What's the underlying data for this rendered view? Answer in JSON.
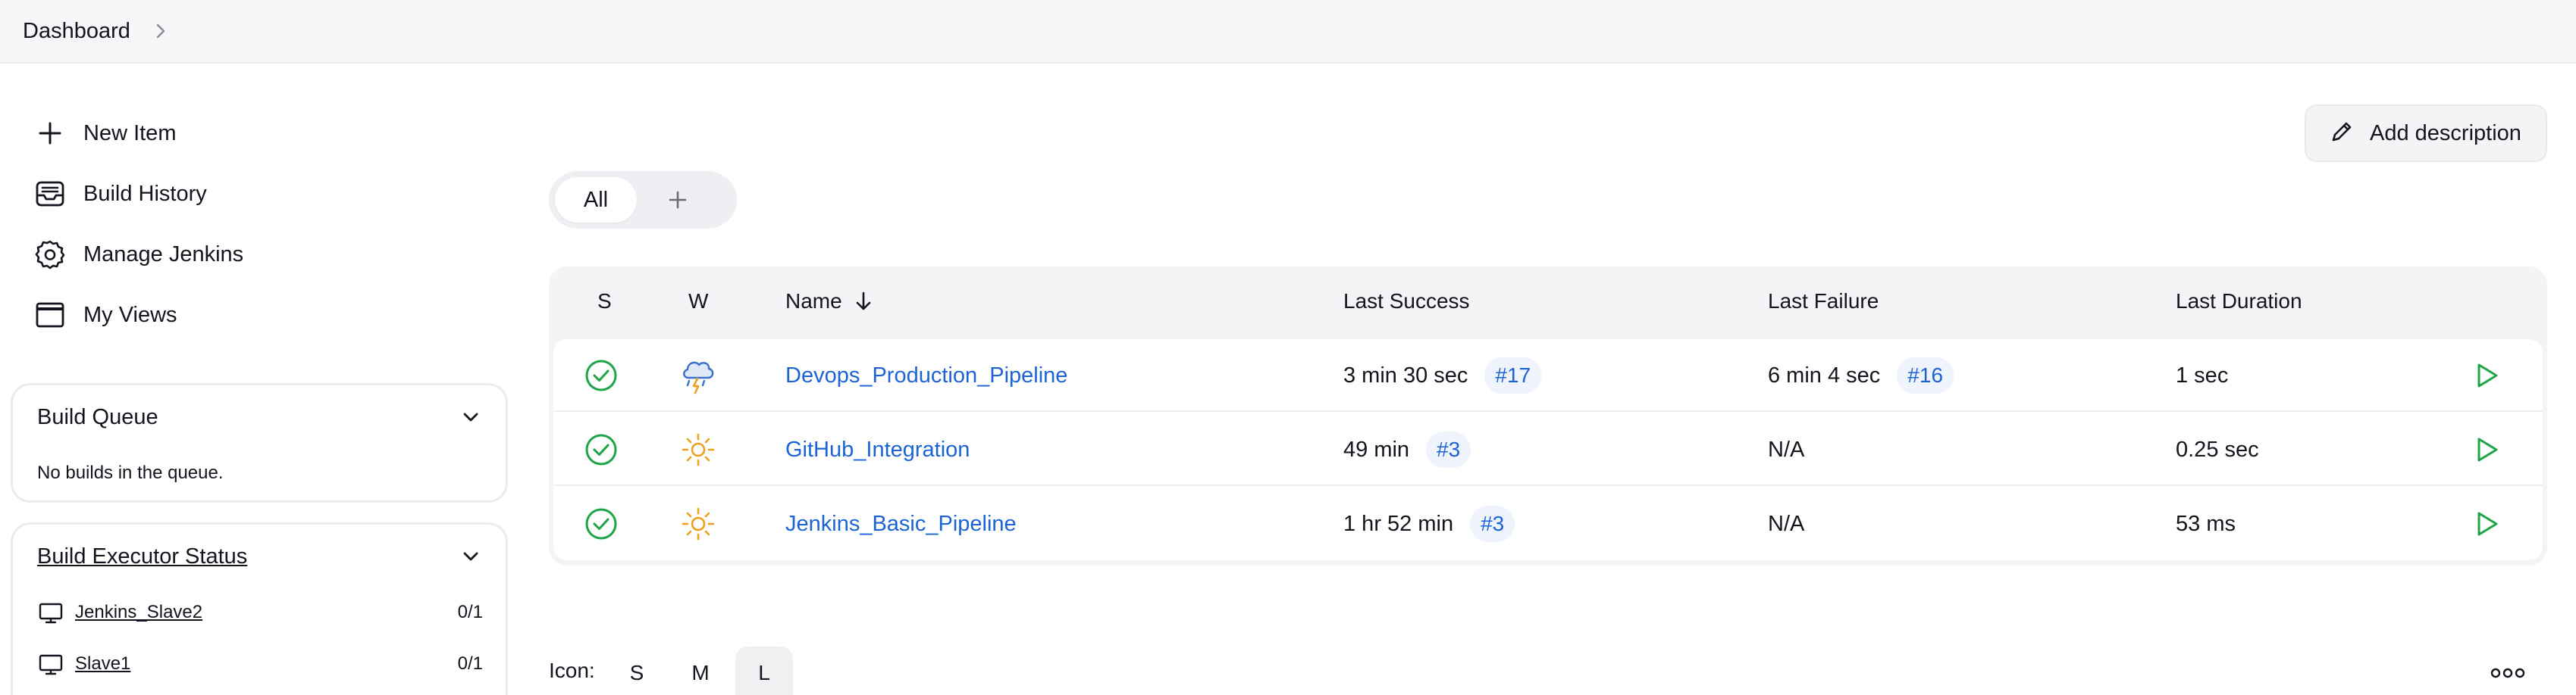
{
  "breadcrumb": {
    "root": "Dashboard"
  },
  "tasks": [
    {
      "label": "New Item",
      "icon": "plus-icon"
    },
    {
      "label": "Build History",
      "icon": "inbox-icon"
    },
    {
      "label": "Manage Jenkins",
      "icon": "gear-icon"
    },
    {
      "label": "My Views",
      "icon": "window-icon"
    }
  ],
  "build_queue": {
    "title": "Build Queue",
    "empty_text": "No builds in the queue."
  },
  "executors": {
    "title": "Build Executor Status",
    "nodes": [
      {
        "name": "Jenkins_Slave2",
        "count": "0/1"
      },
      {
        "name": "Slave1",
        "count": "0/1"
      }
    ]
  },
  "add_description": {
    "label": "Add description"
  },
  "view_tabs": {
    "all": "All"
  },
  "table": {
    "headers": {
      "s": "S",
      "w": "W",
      "name": "Name",
      "last_success": "Last Success",
      "last_failure": "Last Failure",
      "last_duration": "Last Duration"
    },
    "rows": [
      {
        "status": "success",
        "weather": "thunderstorm-icon",
        "name": "Devops_Production_Pipeline",
        "last_success": "3 min 30 sec",
        "success_build": "#17",
        "last_failure": "6 min 4 sec",
        "failure_build": "#16",
        "duration": "1 sec"
      },
      {
        "status": "success",
        "weather": "sunny-icon",
        "name": "GitHub_Integration",
        "last_success": "49 min",
        "success_build": "#3",
        "last_failure": "N/A",
        "failure_build": "",
        "duration": "0.25 sec"
      },
      {
        "status": "success",
        "weather": "sunny-icon",
        "name": "Jenkins_Basic_Pipeline",
        "last_success": "1 hr 52 min",
        "success_build": "#3",
        "last_failure": "N/A",
        "failure_build": "",
        "duration": "53 ms"
      }
    ]
  },
  "icon_size": {
    "label": "Icon:",
    "options": [
      "S",
      "M",
      "L"
    ],
    "selected": "L"
  },
  "colors": {
    "accent_link": "#1c64d6",
    "success_green": "#1ea446",
    "sun_orange": "#f0a020",
    "storm_blue": "#3b6fc9"
  }
}
